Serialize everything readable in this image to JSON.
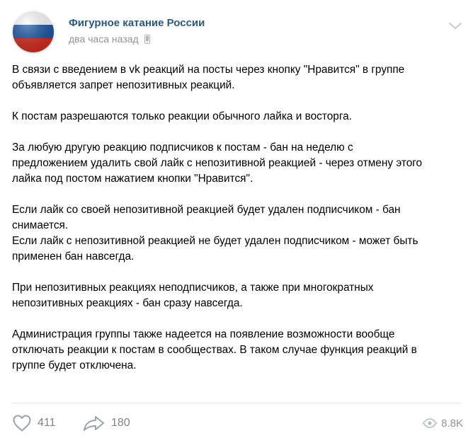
{
  "header": {
    "author": "Фигурное катание России",
    "time": "два часа назад",
    "avatar_colors": [
      "#ffffff",
      "#1c57a5",
      "#d52b1e"
    ]
  },
  "post": {
    "paragraphs": [
      [
        "В связи с введением в vk реакций на посты через кнопку \"Нравится\" в группе",
        "объявляется запрет непозитивных реакций."
      ],
      [
        "К постам разрешаются только реакции обычного лайка и восторга."
      ],
      [
        "За любую другую реакцию подписчиков к постам - бан на неделю с",
        "предложением удалить свой лайк с непозитивной реакцией - через отмену этого",
        "лайка под постом нажатием кнопки \"Нравится\"."
      ],
      [
        "Если лайк со своей непозитивной реакцией будет удален подписчиком - бан",
        "снимается.",
        "Если лайк с непозитивной реакцией не будет удален подписчиком - может быть",
        "применен бан навсегда."
      ],
      [
        "При непозитивных реакциях неподписчиков, а также при многократных",
        "непозитивных реакциях - бан сразу навсегда."
      ],
      [
        "Администрация группы также надеется на появление возможности вообще",
        "отключать реакции к постам в сообществах. В таком случае функция реакций в",
        "группе будет отключена."
      ]
    ]
  },
  "footer": {
    "likes": "411",
    "shares": "180",
    "views": "8.8K"
  },
  "icons": {
    "time": "phone-icon",
    "menu": "chevron-down-icon",
    "like": "heart-icon",
    "share": "share-arrow-icon",
    "views": "eye-icon"
  },
  "colors": {
    "author": "#2a5885",
    "meta": "#939393",
    "footer": "#828282"
  }
}
